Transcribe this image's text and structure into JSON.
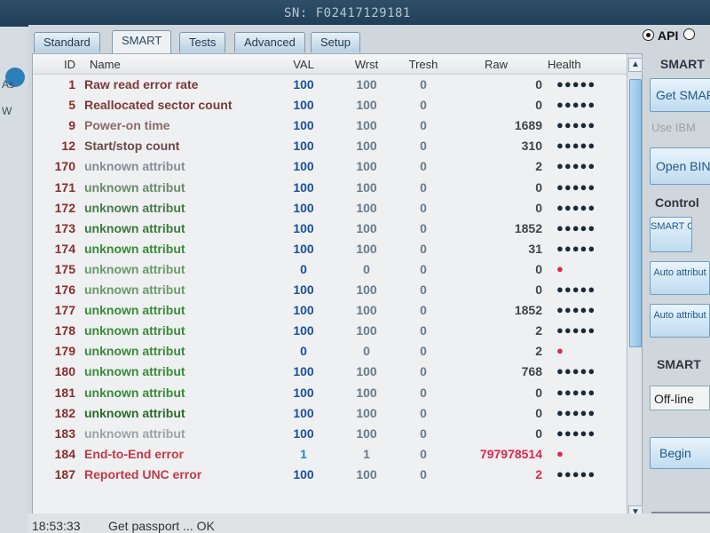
{
  "app": {
    "serial": "SN: F02417129181",
    "left_labels": [
      "As",
      "W"
    ]
  },
  "tabs": [
    {
      "label": "Standard",
      "active": false
    },
    {
      "label": "SMART",
      "active": true
    },
    {
      "label": "Tests",
      "active": false
    },
    {
      "label": "Advanced",
      "active": false
    },
    {
      "label": "Setup",
      "active": false
    }
  ],
  "api_label": "API",
  "columns": {
    "id": "ID",
    "name": "Name",
    "val": "VAL",
    "wrst": "Wrst",
    "tresh": "Tresh",
    "raw": "Raw",
    "health": "Health"
  },
  "rows": [
    {
      "id": "1",
      "name": "Raw read error rate",
      "val": "100",
      "wrst": "100",
      "tresh": "0",
      "raw": "0",
      "health": "●●●●●",
      "name_color": "#7a3a3a",
      "raw_color": "#444444",
      "val_color": "#1c4f9c"
    },
    {
      "id": "5",
      "name": "Reallocated sector count",
      "val": "100",
      "wrst": "100",
      "tresh": "0",
      "raw": "0",
      "health": "●●●●●",
      "name_color": "#7a3a3a",
      "raw_color": "#444444",
      "val_color": "#1c4f9c"
    },
    {
      "id": "9",
      "name": "Power-on time",
      "val": "100",
      "wrst": "100",
      "tresh": "0",
      "raw": "1689",
      "health": "●●●●●",
      "name_color": "#8a6a6a",
      "raw_color": "#444444",
      "val_color": "#1c4f9c"
    },
    {
      "id": "12",
      "name": "Start/stop count",
      "val": "100",
      "wrst": "100",
      "tresh": "0",
      "raw": "310",
      "health": "●●●●●",
      "name_color": "#6a4a4a",
      "raw_color": "#444444",
      "val_color": "#1c4f9c"
    },
    {
      "id": "170",
      "name": "unknown attribut",
      "val": "100",
      "wrst": "100",
      "tresh": "0",
      "raw": "2",
      "health": "●●●●●",
      "name_color": "#8a8a9a",
      "raw_color": "#444444",
      "val_color": "#1c4f9c"
    },
    {
      "id": "171",
      "name": "unknown attribut",
      "val": "100",
      "wrst": "100",
      "tresh": "0",
      "raw": "0",
      "health": "●●●●●",
      "name_color": "#6a8a6a",
      "raw_color": "#444444",
      "val_color": "#1c4f9c"
    },
    {
      "id": "172",
      "name": "unknown attribut",
      "val": "100",
      "wrst": "100",
      "tresh": "0",
      "raw": "0",
      "health": "●●●●●",
      "name_color": "#4a7a4a",
      "raw_color": "#444444",
      "val_color": "#1c4f9c"
    },
    {
      "id": "173",
      "name": "unknown attribut",
      "val": "100",
      "wrst": "100",
      "tresh": "0",
      "raw": "1852",
      "health": "●●●●●",
      "name_color": "#3a7a3a",
      "raw_color": "#444444",
      "val_color": "#1c4f9c"
    },
    {
      "id": "174",
      "name": "unknown attribut",
      "val": "100",
      "wrst": "100",
      "tresh": "0",
      "raw": "31",
      "health": "●●●●●",
      "name_color": "#3a8a3a",
      "raw_color": "#444444",
      "val_color": "#1c4f9c"
    },
    {
      "id": "175",
      "name": "unknown attribut",
      "val": "0",
      "wrst": "0",
      "tresh": "0",
      "raw": "0",
      "health": "●",
      "name_color": "#6a9a6a",
      "raw_color": "#444444",
      "val_color": "#1c4f9c",
      "health_red": true
    },
    {
      "id": "176",
      "name": "unknown attribut",
      "val": "100",
      "wrst": "100",
      "tresh": "0",
      "raw": "0",
      "health": "●●●●●",
      "name_color": "#6a9a6a",
      "raw_color": "#444444",
      "val_color": "#1c4f9c"
    },
    {
      "id": "177",
      "name": "unknown attribut",
      "val": "100",
      "wrst": "100",
      "tresh": "0",
      "raw": "1852",
      "health": "●●●●●",
      "name_color": "#3a8a3a",
      "raw_color": "#444444",
      "val_color": "#1c4f9c"
    },
    {
      "id": "178",
      "name": "unknown attribut",
      "val": "100",
      "wrst": "100",
      "tresh": "0",
      "raw": "2",
      "health": "●●●●●",
      "name_color": "#3a8a3a",
      "raw_color": "#444444",
      "val_color": "#1c4f9c"
    },
    {
      "id": "179",
      "name": "unknown attribut",
      "val": "0",
      "wrst": "0",
      "tresh": "0",
      "raw": "2",
      "health": "●",
      "name_color": "#3a8a3a",
      "raw_color": "#444444",
      "val_color": "#1c4f9c",
      "health_red": true
    },
    {
      "id": "180",
      "name": "unknown attribut",
      "val": "100",
      "wrst": "100",
      "tresh": "0",
      "raw": "768",
      "health": "●●●●●",
      "name_color": "#3a8a3a",
      "raw_color": "#444444",
      "val_color": "#1c4f9c"
    },
    {
      "id": "181",
      "name": "unknown attribut",
      "val": "100",
      "wrst": "100",
      "tresh": "0",
      "raw": "0",
      "health": "●●●●●",
      "name_color": "#3a8a3a",
      "raw_color": "#444444",
      "val_color": "#1c4f9c"
    },
    {
      "id": "182",
      "name": "unknown attribut",
      "val": "100",
      "wrst": "100",
      "tresh": "0",
      "raw": "0",
      "health": "●●●●●",
      "name_color": "#2a6a2a",
      "raw_color": "#444444",
      "val_color": "#1c4f9c"
    },
    {
      "id": "183",
      "name": "unknown attribut",
      "val": "100",
      "wrst": "100",
      "tresh": "0",
      "raw": "0",
      "health": "●●●●●",
      "name_color": "#a0a0a8",
      "raw_color": "#444444",
      "val_color": "#1c4f9c"
    },
    {
      "id": "184",
      "name": "End-to-End error",
      "val": "1",
      "wrst": "1",
      "tresh": "0",
      "raw": "797978514",
      "health": "●",
      "name_color": "#c23a4a",
      "raw_color": "#e0264e",
      "val_color": "#1c8fc0",
      "health_red": true
    },
    {
      "id": "187",
      "name": "Reported UNC error",
      "val": "100",
      "wrst": "100",
      "tresh": "0",
      "raw": "2",
      "health": "●●●●●",
      "name_color": "#c23a4a",
      "raw_color": "#e0264e",
      "val_color": "#1c4f9c"
    }
  ],
  "right_panel": {
    "smart_title": "SMART",
    "get_smart_label": "Get SMART",
    "use_ibm_label": "Use IBM",
    "open_bin_label": "Open BIN",
    "control_title": "Control",
    "smart_on_label": "SMART ON",
    "auto_attr1_label": "Auto attribut",
    "auto_attr2_label": "Auto attribut",
    "smart_test_title": "SMART",
    "offline_value": "Off-line",
    "begin_label": "Begin"
  },
  "status": {
    "time": "18:53:33",
    "message": "Get passport ... OK"
  },
  "colors": {
    "accent": "#2d7fb8",
    "error": "#e0264e"
  }
}
